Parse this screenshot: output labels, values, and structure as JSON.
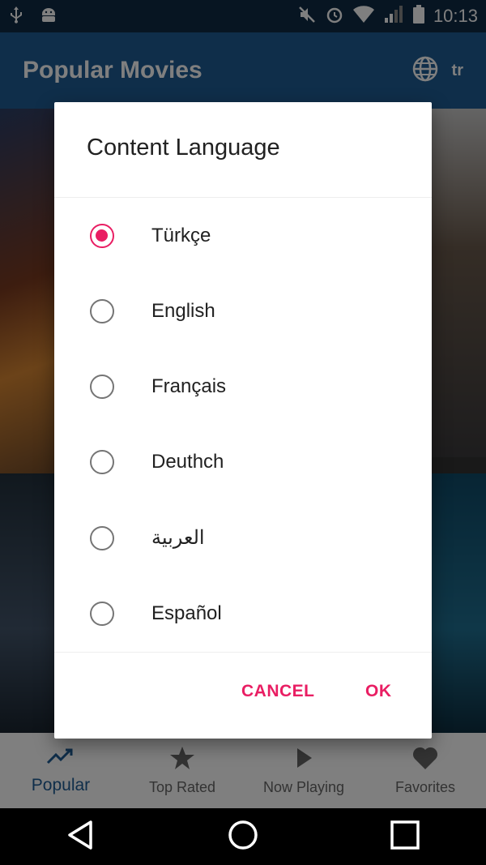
{
  "status_bar": {
    "time": "10:13",
    "icons": [
      "usb-icon",
      "android-icon",
      "mute-icon",
      "alarm-icon",
      "wifi-icon",
      "signal-icon",
      "battery-icon"
    ]
  },
  "app_bar": {
    "title": "Popular Movies",
    "language_code": "tr",
    "language_icon": "globe-icon"
  },
  "bottom_nav": {
    "items": [
      {
        "label": "Popular",
        "icon": "trending-up-icon",
        "active": true
      },
      {
        "label": "Top Rated",
        "icon": "star-icon",
        "active": false
      },
      {
        "label": "Now Playing",
        "icon": "play-icon",
        "active": false
      },
      {
        "label": "Favorites",
        "icon": "heart-icon",
        "active": false
      }
    ]
  },
  "dialog": {
    "title": "Content Language",
    "options": [
      {
        "label": "Türkçe",
        "selected": true
      },
      {
        "label": "English",
        "selected": false
      },
      {
        "label": "Français",
        "selected": false
      },
      {
        "label": "Deuthch",
        "selected": false
      },
      {
        "label": "العربية",
        "selected": false
      },
      {
        "label": "Español",
        "selected": false
      }
    ],
    "cancel_label": "CANCEL",
    "ok_label": "OK"
  },
  "colors": {
    "primary": "#1e5c95",
    "accent": "#e91e63",
    "status_bar": "#0e2a44"
  }
}
